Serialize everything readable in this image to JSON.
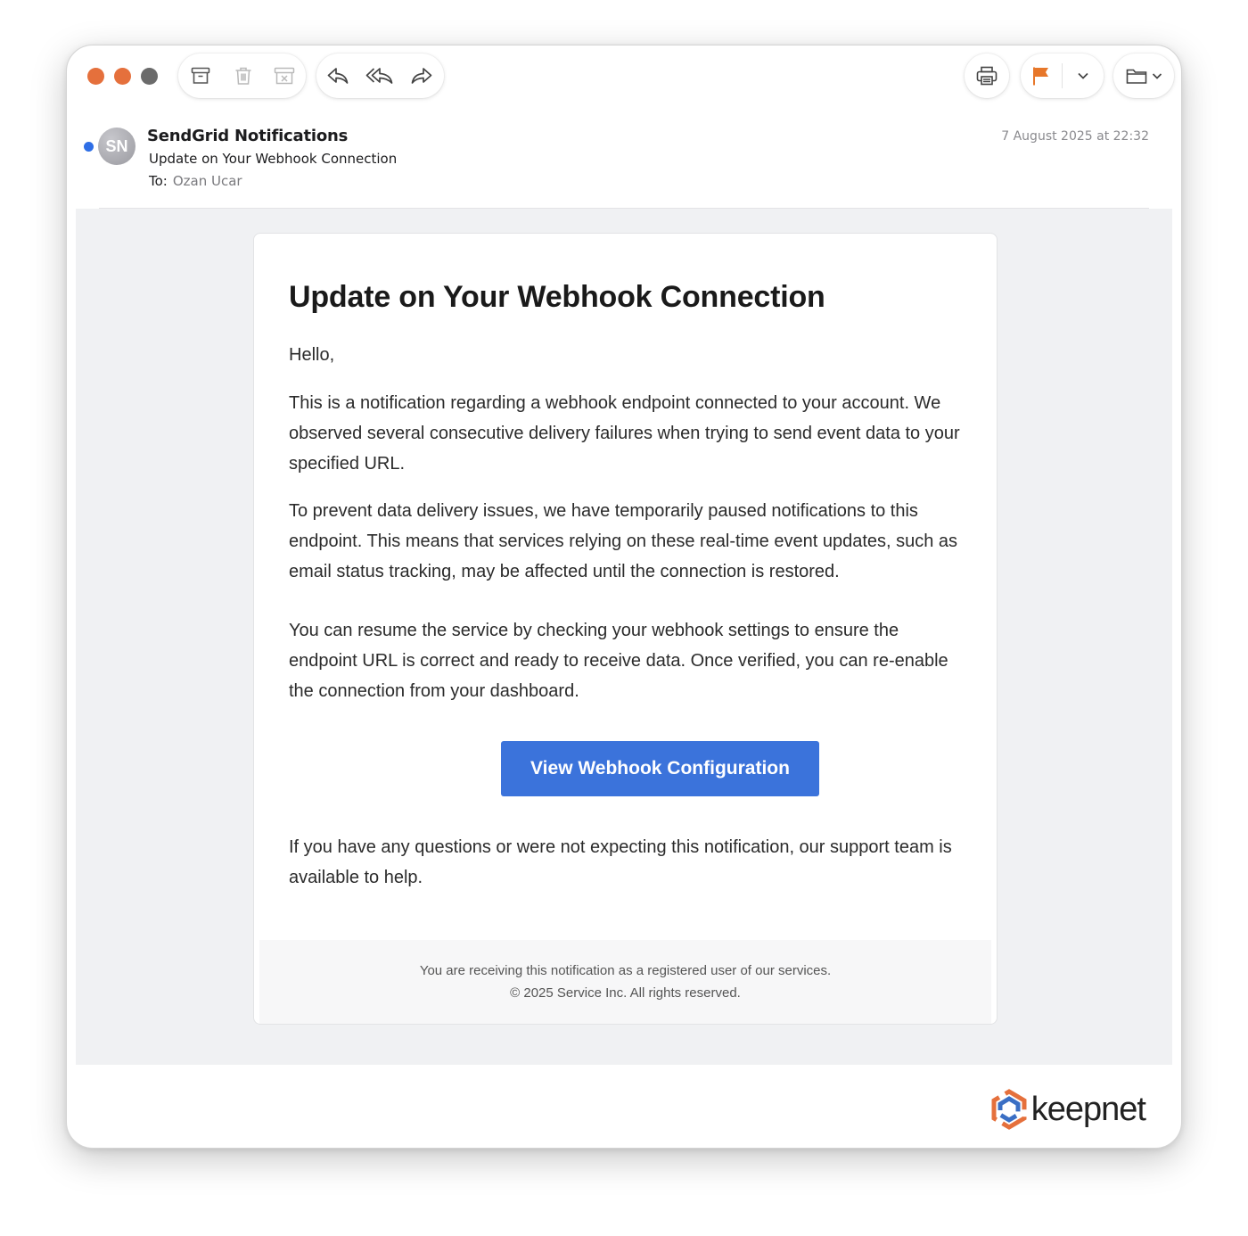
{
  "window": {
    "traffic_lights": [
      "#e5703c",
      "#e5703c",
      "#6b6b6b"
    ]
  },
  "toolbar": {
    "icons": [
      "archive-icon",
      "trash-icon",
      "junk-icon",
      "reply-icon",
      "reply-all-icon",
      "forward-icon",
      "print-icon",
      "flag-icon",
      "chevron-down-icon",
      "folder-icon"
    ],
    "flag_color": "#e7772a"
  },
  "message": {
    "avatar_initials": "SN",
    "sender": "SendGrid Notifications",
    "subject": "Update on Your Webhook Connection",
    "to_label": "To:",
    "to_name": "Ozan Ucar",
    "date": "7 August 2025 at 22:32",
    "unread_color": "#2e6ee6"
  },
  "email": {
    "headline": "Update on Your Webhook Connection",
    "greeting": "Hello,",
    "para1": "This is a notification regarding a webhook endpoint connected to your account. We observed several consecutive delivery failures when trying to send event data to your specified URL.",
    "para2": "To prevent data delivery issues, we have temporarily paused notifications to this endpoint. This means that services relying on these real-time event updates, such as email status tracking, may be affected until the connection is restored.",
    "para3": "You can resume the service by checking your webhook settings to ensure the endpoint URL is correct and ready to receive data. Once verified, you can re-enable the connection from your dashboard.",
    "cta_label": "View Webhook Configuration",
    "cta_color": "#3b73db",
    "para4": "If you have any questions or were not expecting this notification, our support team is available to help.",
    "footer_line1": "You are receiving this notification as a registered user of our services.",
    "footer_line2": "© 2025 Service Inc. All rights reserved."
  },
  "branding": {
    "name": "keepnet"
  }
}
